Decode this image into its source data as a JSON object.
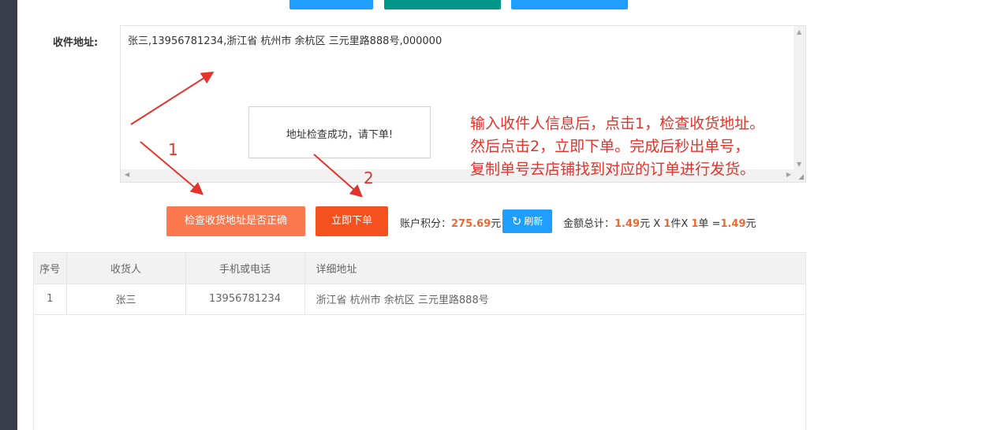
{
  "address_form": {
    "label": "收件地址:",
    "textarea_value": "张三,13956781234,浙江省 杭州市 余杭区 三元里路888号,000000"
  },
  "popup": {
    "message": "地址检查成功，请下单!"
  },
  "annotation": {
    "lines": [
      "输入收件人信息后，点击1，检查收货地址。",
      "然后点击2，立即下单。完成后秒出单号，",
      "复制单号去店铺找到对应的订单进行发货。"
    ],
    "step1": "1",
    "step2": "2",
    "color": "#e4332b"
  },
  "actions": {
    "check_address_label": "检查收货地址是否正确",
    "place_order_label": "立即下单",
    "points_label": "账户积分：",
    "points_value": "275.69",
    "points_unit": "元",
    "refresh_label": "刷新",
    "total_label": "金额总计：",
    "unit_price": "1.49",
    "yuan": "元",
    "times": " X ",
    "qty": "1",
    "qty_unit": "件X ",
    "orders": "1",
    "orders_unit": "单 =",
    "total_value": "1.49",
    "total_unit": "元"
  },
  "table": {
    "headers": [
      "序号",
      "收货人",
      "手机或电话",
      "详细地址"
    ],
    "rows": [
      [
        "1",
        "张三",
        "13956781234",
        "浙江省 杭州市 余杭区 三元里路888号"
      ]
    ]
  },
  "colors": {
    "primary_blue": "#1e9fff",
    "teal": "#009688",
    "orange_button": "#fc784f",
    "deep_orange_button": "#f4511e",
    "highlight": "#f0682e"
  }
}
